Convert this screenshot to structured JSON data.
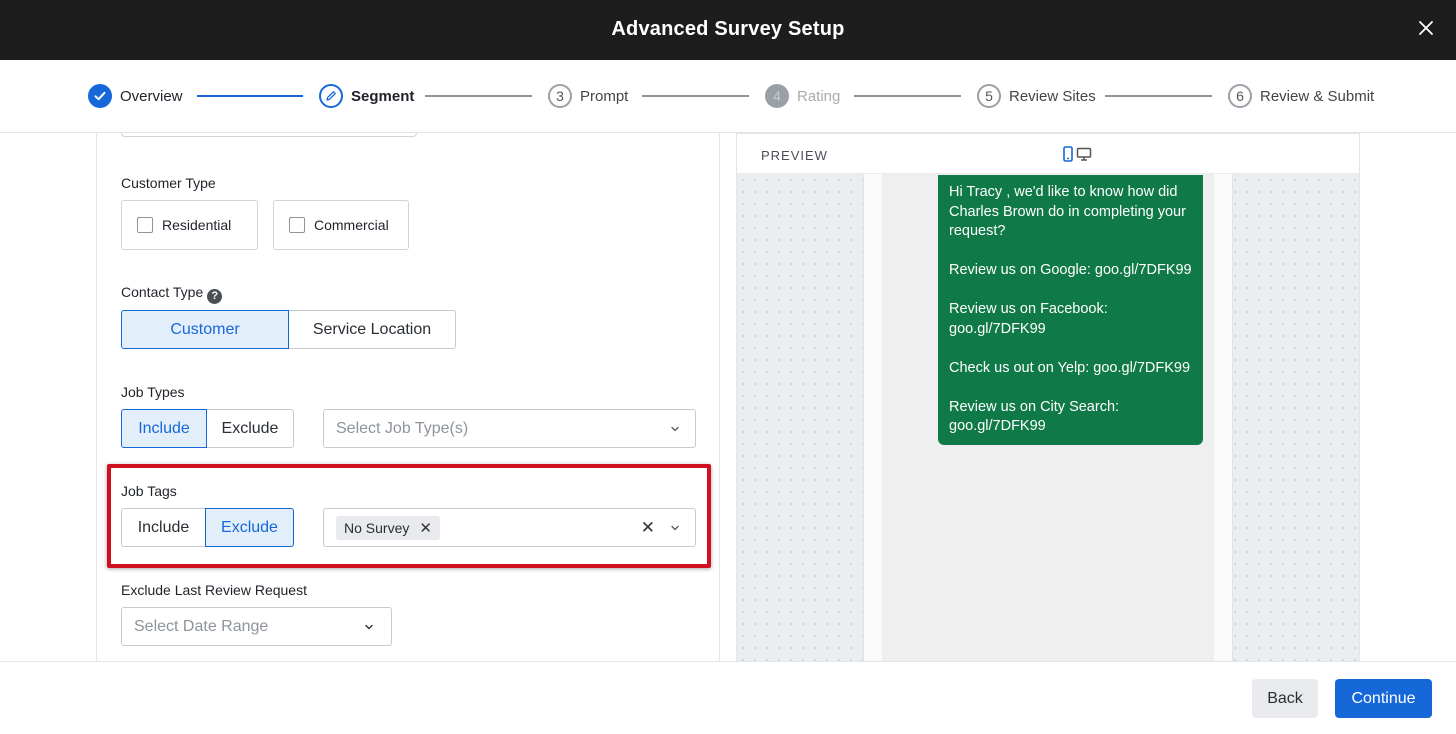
{
  "header": {
    "title": "Advanced Survey Setup"
  },
  "stepper": {
    "steps": [
      {
        "label": "Overview",
        "number": "",
        "state": "done"
      },
      {
        "label": "Segment",
        "number": "",
        "state": "current"
      },
      {
        "label": "Prompt",
        "number": "3",
        "state": "todo"
      },
      {
        "label": "Rating",
        "number": "4",
        "state": "disabled"
      },
      {
        "label": "Review Sites",
        "number": "5",
        "state": "todo"
      },
      {
        "label": "Review & Submit",
        "number": "6",
        "state": "todo"
      }
    ]
  },
  "form": {
    "customer_type": {
      "label": "Customer Type",
      "options": [
        "Residential",
        "Commercial"
      ]
    },
    "contact_type": {
      "label": "Contact Type",
      "options": [
        "Customer",
        "Service Location"
      ],
      "selected": "Customer"
    },
    "job_types": {
      "label": "Job Types",
      "include_label": "Include",
      "exclude_label": "Exclude",
      "selected": "Include",
      "placeholder": "Select Job Type(s)"
    },
    "job_tags": {
      "label": "Job Tags",
      "include_label": "Include",
      "exclude_label": "Exclude",
      "selected": "Exclude",
      "tags": [
        "No Survey"
      ]
    },
    "exclude_last_review": {
      "label": "Exclude Last Review Request",
      "placeholder": "Select Date Range"
    }
  },
  "preview": {
    "title": "PREVIEW",
    "message": "Hi Tracy , we'd like to know how did Charles Brown do in completing your request?\n\nReview us on Google: goo.gl/7DFK99\n\nReview us on Facebook: goo.gl/7DFK99\n\nCheck us out on Yelp: goo.gl/7DFK99\n\nReview us on City Search: goo.gl/7DFK99",
    "bubble_color": "#0f7a47"
  },
  "footer": {
    "back_label": "Back",
    "continue_label": "Continue"
  },
  "colors": {
    "accent": "#1668d9",
    "highlight": "#d0101f",
    "header_bg": "#1d1d1d"
  }
}
